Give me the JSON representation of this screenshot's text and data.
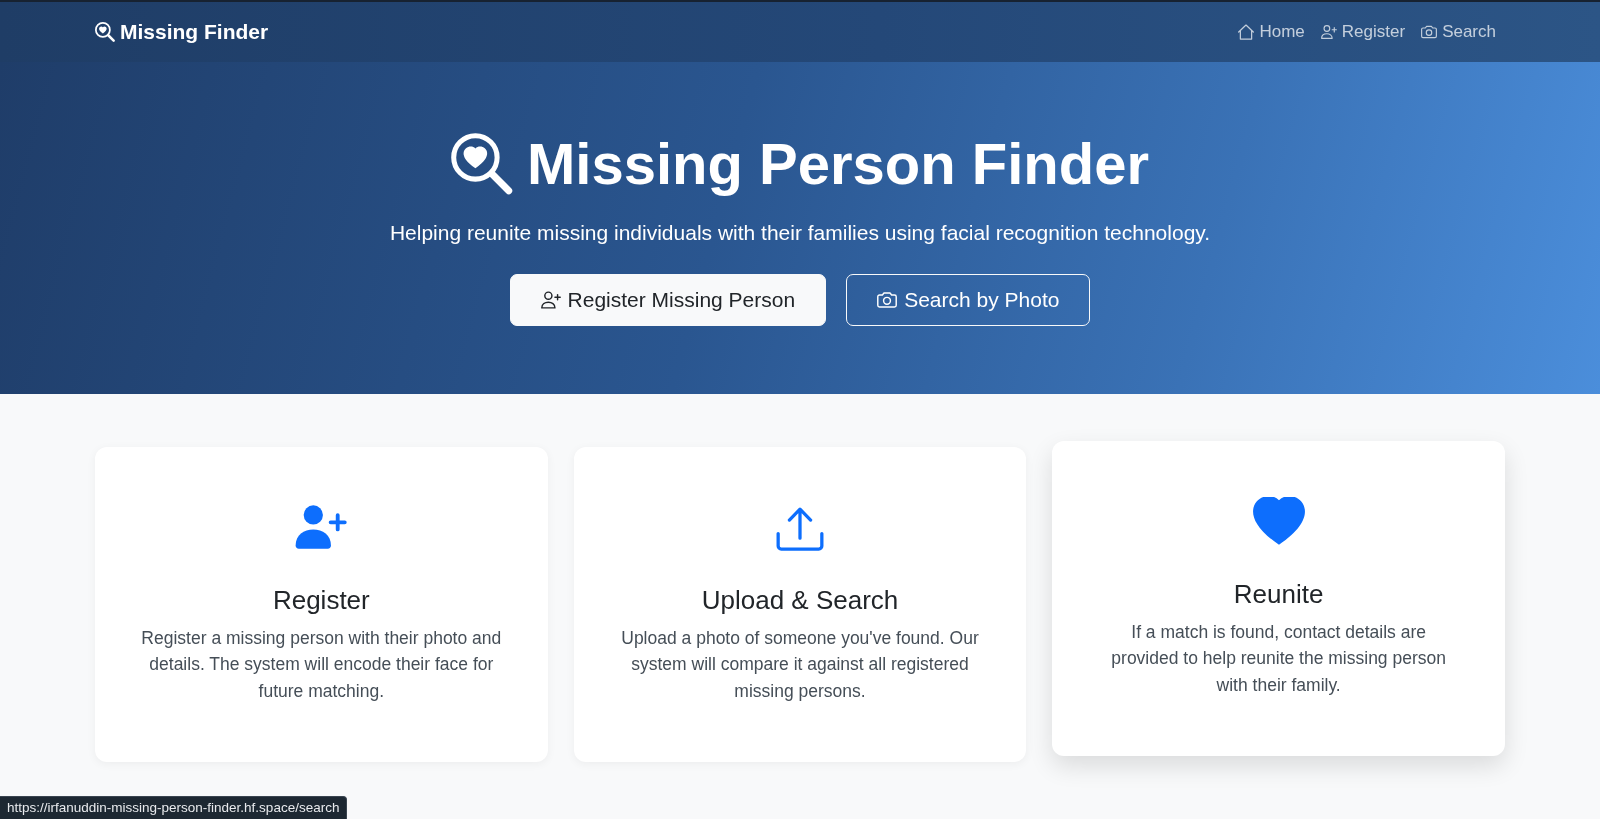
{
  "navbar": {
    "brand": "Missing Finder",
    "links": [
      {
        "label": "Home"
      },
      {
        "label": "Register"
      },
      {
        "label": "Search"
      }
    ]
  },
  "hero": {
    "title": "Missing Person Finder",
    "subtitle": "Helping reunite missing individuals with their families using facial recognition technology.",
    "buttons": [
      {
        "label": "Register Missing Person",
        "kind": "light"
      },
      {
        "label": "Search by Photo",
        "kind": "outline"
      }
    ]
  },
  "features": [
    {
      "title": "Register",
      "description": "Register a missing person with their photo and details. The system will encode their face for future matching.",
      "hovered": false
    },
    {
      "title": "Upload & Search",
      "description": "Upload a photo of someone you've found. Our system will compare it against all registered missing persons.",
      "hovered": false
    },
    {
      "title": "Reunite",
      "description": "If a match is found, contact details are provided to help reunite the missing person with their family.",
      "hovered": true
    }
  ],
  "status_bar": {
    "url": "https://irfanuddin-missing-person-finder.hf.space/search"
  }
}
